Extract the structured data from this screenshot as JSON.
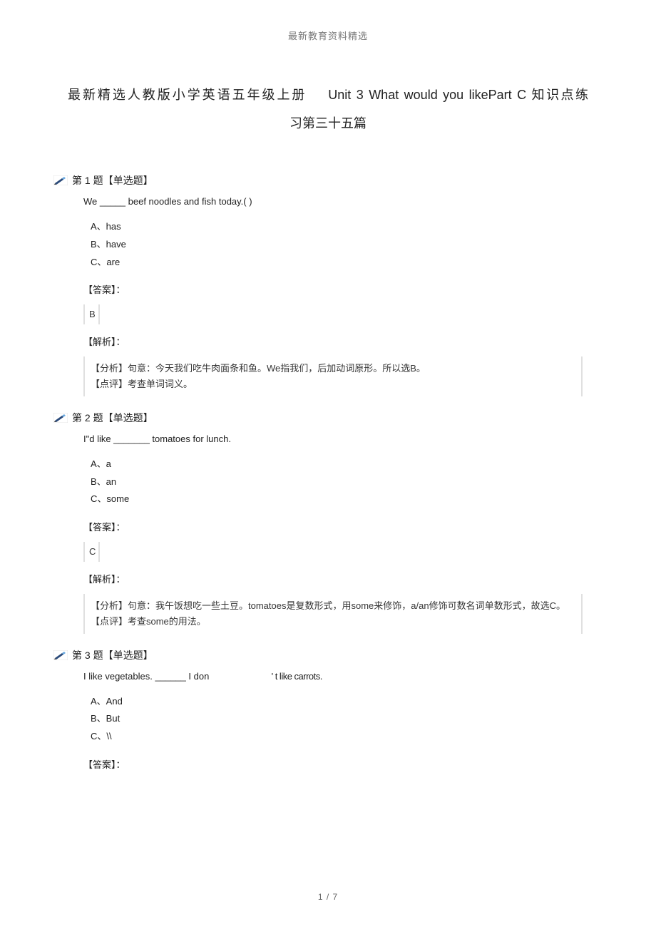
{
  "header": "最新教育资料精选",
  "title_line1_cn_prefix": "最新精选人教版小学英语五年级上册",
  "title_line1_en": "Unit 3 What would you likePart C",
  "title_line1_cn_suffix": "知识点练",
  "title_line2": "习第三十五篇",
  "q1": {
    "bullet": "第 1 题【单选题】",
    "stem": "We _____ beef noodles and fish today.(        )",
    "opts": {
      "a": "A、has",
      "b": "B、have",
      "c": "C、are"
    },
    "ans_label": "【答案】：",
    "ans": "B",
    "ana_label": "【解析】：",
    "ana_l1": "【分析】句意：今天我们吃牛肉面条和鱼。We指我们，后加动词原形。所以选B。",
    "ana_l2": "【点评】考查单词词义。"
  },
  "q2": {
    "bullet": "第 2 题【单选题】",
    "stem": "I\"d like _______ tomatoes for lunch.",
    "opts": {
      "a": "A、a",
      "b": "B、an",
      "c": "C、some"
    },
    "ans_label": "【答案】：",
    "ans": "C",
    "ana_label": "【解析】：",
    "ana_l1": "【分析】句意：我午饭想吃一些土豆。tomatoes是复数形式，用some来修饰，a/an修饰可数名词单数形式，故选C。",
    "ana_l2": "【点评】考查some的用法。"
  },
  "q3": {
    "bullet": "第 3 题【单选题】",
    "stem_p1": "I like vegetables. ______ I don",
    "stem_p2": "'  t like carrots.",
    "opts": {
      "a": "A、And",
      "b": "B、But",
      "c": "C、\\\\"
    },
    "ans_label": "【答案】："
  },
  "page_num": "1  /  7"
}
